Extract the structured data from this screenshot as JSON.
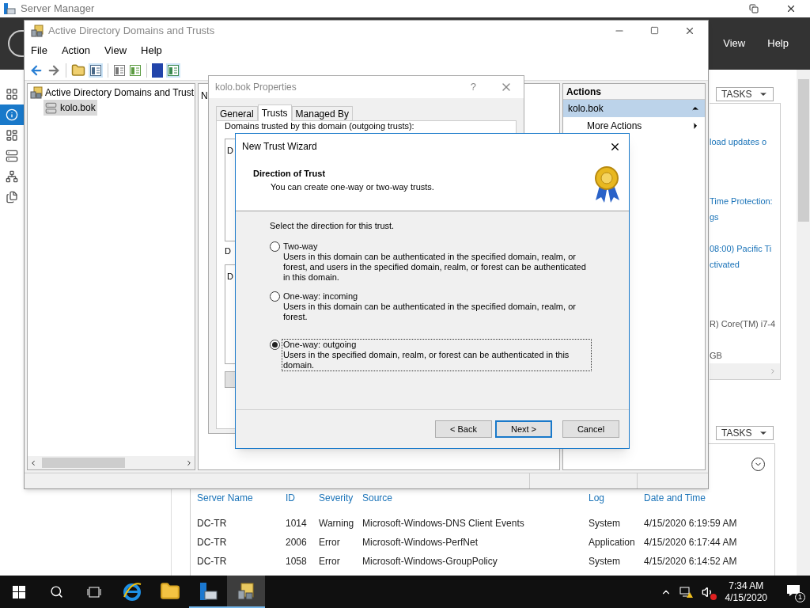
{
  "server_manager": {
    "title": "Server Manager",
    "menu": [
      "View",
      "Help"
    ],
    "nav_items": [
      {
        "kind": "dashboard",
        "selected": false
      },
      {
        "kind": "local",
        "selected": true
      },
      {
        "kind": "all",
        "selected": false
      },
      {
        "kind": "adds",
        "selected": false
      },
      {
        "kind": "dns",
        "selected": false
      },
      {
        "kind": "files",
        "selected": false
      }
    ],
    "tasks_buttons": [
      "TASKS",
      "TASKS"
    ],
    "properties_fragments": [
      {
        "text": "load updates o",
        "kind": "link"
      },
      {
        "text": "Time Protection:",
        "kind": "link"
      },
      {
        "text": "gs",
        "kind": "link"
      },
      {
        "text": "08:00) Pacific Ti",
        "kind": "link"
      },
      {
        "text": "ctivated",
        "kind": "link"
      },
      {
        "text": "R) Core(TM) i7-4",
        "kind": "value"
      },
      {
        "text": "GB",
        "kind": "value"
      }
    ],
    "events": {
      "columns": [
        "Server Name",
        "ID",
        "Severity",
        "Source",
        "Log",
        "Date and Time"
      ],
      "rows": [
        [
          "DC-TR",
          "1014",
          "Warning",
          "Microsoft-Windows-DNS Client Events",
          "System",
          "4/15/2020 6:19:59 AM"
        ],
        [
          "DC-TR",
          "2006",
          "Error",
          "Microsoft-Windows-PerfNet",
          "Application",
          "4/15/2020 6:17:44 AM"
        ],
        [
          "DC-TR",
          "1058",
          "Error",
          "Microsoft-Windows-GroupPolicy",
          "System",
          "4/15/2020 6:14:52 AM"
        ]
      ]
    }
  },
  "addt": {
    "title": "Active Directory Domains and Trusts",
    "menu": [
      "File",
      "Action",
      "View",
      "Help"
    ],
    "tree": {
      "label": "Active Directory Domains and Trust",
      "children": [
        {
          "label": "kolo.bok",
          "selected": true
        }
      ]
    },
    "middle_header": "N",
    "actions": {
      "title": "Actions",
      "section": "kolo.bok",
      "items": [
        "More Actions"
      ]
    }
  },
  "properties": {
    "title": "kolo.bok Properties",
    "help": "?",
    "tabs": [
      {
        "label": "General",
        "selected": false
      },
      {
        "label": "Trusts",
        "selected": true
      },
      {
        "label": "Managed By",
        "selected": false
      }
    ],
    "outgoing_label": "Domains trusted by this domain (outgoing trusts):",
    "outgoing_list_fragment": "D",
    "incoming_label_fragment": "D",
    "incoming_list_fragment": "D"
  },
  "wizard": {
    "title": "New Trust Wizard",
    "heading": "Direction of Trust",
    "subheading": "You can create one-way or two-way trusts.",
    "prompt": "Select the direction for this trust.",
    "options": [
      {
        "label": "Two-way",
        "description": "Users in this domain can be authenticated in the specified domain, realm, or forest, and users in the specified domain, realm, or forest can be authenticated in this domain.",
        "selected": false
      },
      {
        "label": "One-way: incoming",
        "description": "Users in this domain can be authenticated in the specified domain, realm, or forest.",
        "selected": false
      },
      {
        "label": "One-way: outgoing",
        "description": "Users in the specified domain, realm, or forest can be authenticated in this domain.",
        "selected": true
      }
    ],
    "buttons": [
      {
        "label": "< Back",
        "kind": "normal"
      },
      {
        "label": "Next >",
        "kind": "default"
      },
      {
        "label": "Cancel",
        "kind": "normal"
      }
    ]
  },
  "taskbar": {
    "apps": [
      {
        "kind": "ie",
        "running": false,
        "selected": false
      },
      {
        "kind": "explorer",
        "running": false,
        "selected": false
      },
      {
        "kind": "server-manager",
        "running": true,
        "selected": false
      },
      {
        "kind": "addt",
        "running": true,
        "selected": true
      }
    ],
    "time": "7:34 AM",
    "date": "4/15/2020",
    "notifications": "1"
  }
}
